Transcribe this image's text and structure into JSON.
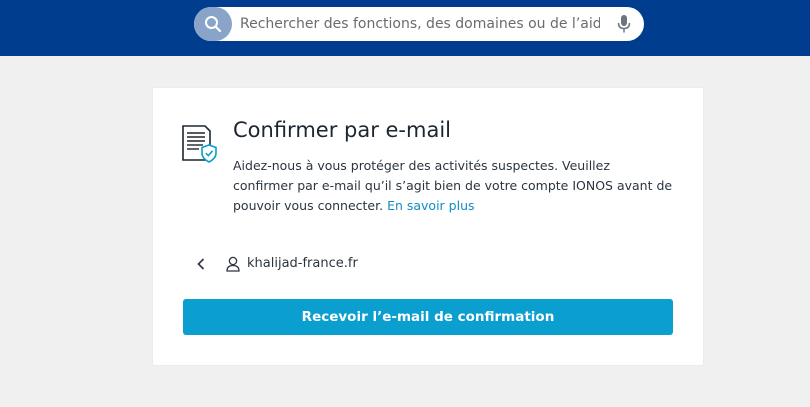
{
  "header": {
    "search": {
      "placeholder": "Rechercher des fonctions, des domaines ou de l’aide",
      "icon": "search-icon",
      "voice_icon": "microphone-icon"
    }
  },
  "card": {
    "icon": "document-shield-icon",
    "title": "Confirmer par e-mail",
    "description": "Aidez-nous à vous protéger des activités suspectes. Veuillez confirmer par e-mail qu’il s’agit bien de votre compte IONOS avant de pouvoir vous connecter.",
    "learn_more": "En savoir plus",
    "account": {
      "back_icon": "chevron-left-icon",
      "user_icon": "user-icon",
      "name": "khalijad-france.fr"
    },
    "primary_button": "Recevoir l’e-mail de confirmation"
  },
  "colors": {
    "header_bg": "#003d8f",
    "accent": "#0b9fd0",
    "link": "#118dc4",
    "page_bg": "#f0f0f0"
  }
}
